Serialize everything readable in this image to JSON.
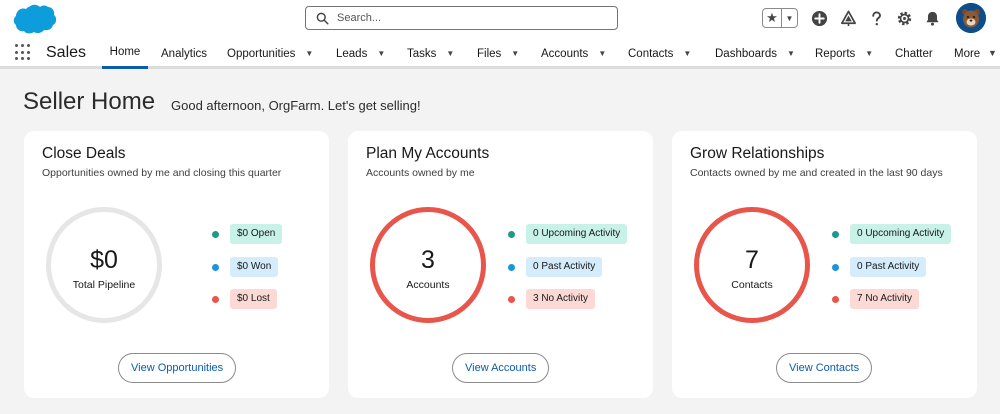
{
  "header": {
    "search_placeholder": "Search...",
    "icons": [
      "salesforce-cloud-logo",
      "search-icon",
      "star-icon",
      "chevron-down-icon",
      "plus-icon",
      "trailhead-icon",
      "help-icon",
      "gear-icon",
      "bell-icon",
      "avatar"
    ]
  },
  "nav": {
    "app_name": "Sales",
    "items": [
      {
        "label": "Home",
        "active": true,
        "dropdown": false
      },
      {
        "label": "Analytics",
        "dropdown": false
      },
      {
        "label": "Opportunities",
        "dropdown": true
      },
      {
        "label": "Leads",
        "dropdown": true
      },
      {
        "label": "Tasks",
        "dropdown": true
      },
      {
        "label": "Files",
        "dropdown": true
      },
      {
        "label": "Accounts",
        "dropdown": true
      },
      {
        "label": "Contacts",
        "dropdown": true
      },
      {
        "label": "Dashboards",
        "dropdown": true
      },
      {
        "label": "Reports",
        "dropdown": true
      },
      {
        "label": "Chatter",
        "dropdown": false
      },
      {
        "label": "More",
        "dropdown": true
      }
    ]
  },
  "page": {
    "title": "Seller Home",
    "greeting": "Good afternoon, OrgFarm. Let's get selling!"
  },
  "cards": [
    {
      "title": "Close Deals",
      "subtitle": "Opportunities owned by me and closing this quarter",
      "value": "$0",
      "value_label": "Total Pipeline",
      "legend": [
        {
          "label": "$0 Open",
          "color": "#1c9a8a"
        },
        {
          "label": "$0 Won",
          "color": "#1b96d8"
        },
        {
          "label": "$0 Lost",
          "color": "#e8554a"
        }
      ],
      "button": "View Opportunities"
    },
    {
      "title": "Plan My Accounts",
      "subtitle": "Accounts owned by me",
      "value": "3",
      "value_label": "Accounts",
      "legend": [
        {
          "label": "0 Upcoming Activity",
          "color": "#1c9a8a"
        },
        {
          "label": "0 Past Activity",
          "color": "#1b96d8"
        },
        {
          "label": "3 No Activity",
          "color": "#e8554a"
        }
      ],
      "button": "View Accounts"
    },
    {
      "title": "Grow Relationships",
      "subtitle": "Contacts owned by me and created in the last 90 days",
      "value": "7",
      "value_label": "Contacts",
      "legend": [
        {
          "label": "0 Upcoming Activity",
          "color": "#1c9a8a"
        },
        {
          "label": "0 Past Activity",
          "color": "#1b96d8"
        },
        {
          "label": "7 No Activity",
          "color": "#e8554a"
        }
      ],
      "button": "View Contacts"
    }
  ],
  "colors": {
    "brand": "#0d9dda",
    "accent": "#0b5cab",
    "ring_empty": "#e6e6e6",
    "ring_red": "#e8554a"
  }
}
